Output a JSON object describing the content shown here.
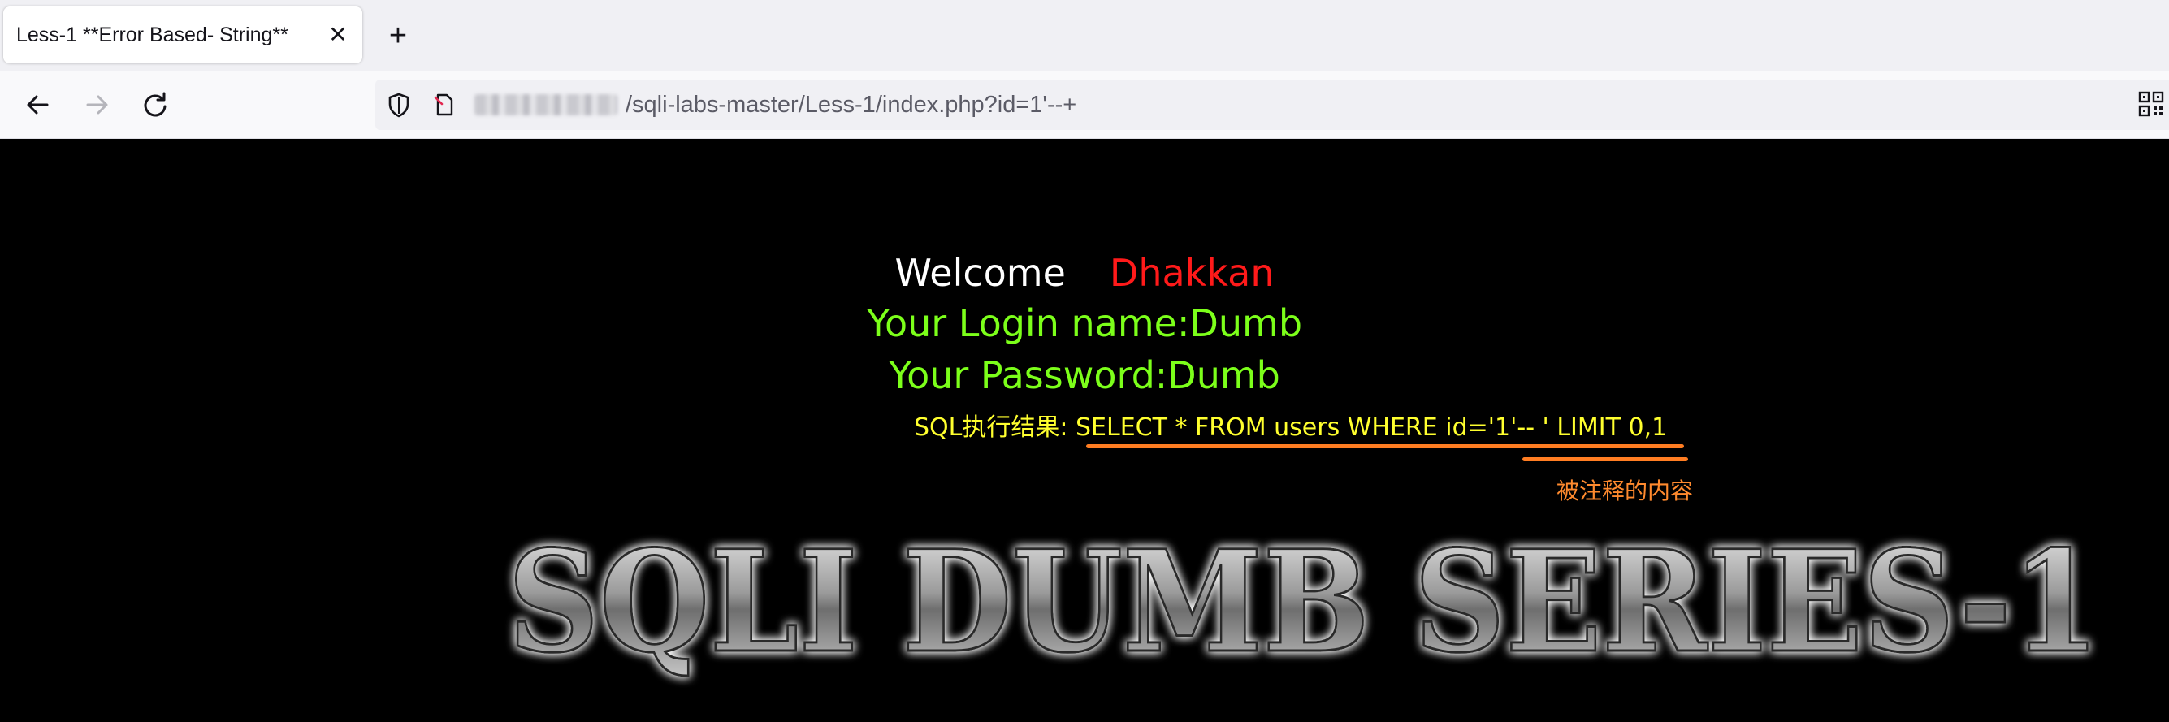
{
  "browser": {
    "tab": {
      "title": "Less-1 **Error Based- String**",
      "close_glyph": "✕"
    },
    "new_tab_glyph": "+",
    "nav": {
      "back_icon": "arrow-left-icon",
      "forward_icon": "arrow-right-icon",
      "reload_icon": "reload-icon"
    },
    "url": {
      "path": "/sqli-labs-master/Less-1/index.php?id=1'--+"
    }
  },
  "page": {
    "welcome_label": "Welcome",
    "welcome_name": "Dhakkan",
    "login_line": "Your Login name:Dumb",
    "password_line": "Your Password:Dumb",
    "sql_line": "SQL执行结果: SELECT * FROM users WHERE id='1'-- ' LIMIT 0,1",
    "annotation": "被注释的内容",
    "banner": "SQLI DUMB SERIES-1"
  },
  "colors": {
    "welcome": "#ffffff",
    "name": "#ff1a1a",
    "login": "#7cff1a",
    "sql": "#ffff2e",
    "annotation": "#ff7d22",
    "background": "#000000"
  }
}
